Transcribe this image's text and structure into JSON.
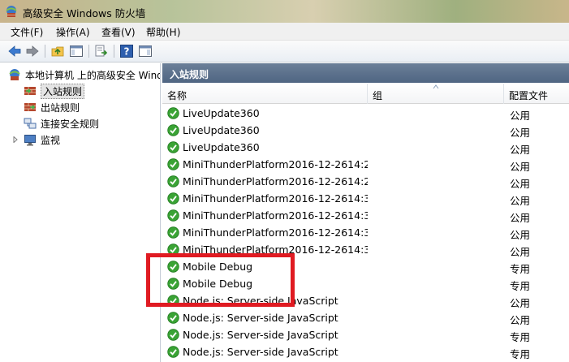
{
  "window": {
    "title": "高级安全 Windows 防火墙"
  },
  "menu": [
    "文件(F)",
    "操作(A)",
    "查看(V)",
    "帮助(H)"
  ],
  "toolbar": {
    "buttons": [
      "back-arrow-icon",
      "forward-arrow-icon",
      "folder-up-icon",
      "show-hide-tree-icon",
      "export-list-icon",
      "help-icon",
      "show-hide-action-pane-icon"
    ]
  },
  "tree": {
    "root": "本地计算机 上的高级安全 Windows 防火墙",
    "items": [
      {
        "label": "入站规则",
        "selected": true
      },
      {
        "label": "出站规则",
        "selected": false
      },
      {
        "label": "连接安全规则",
        "selected": false
      },
      {
        "label": "监视",
        "selected": false
      }
    ]
  },
  "pane": {
    "title": "入站规则",
    "columns": [
      "名称",
      "组",
      "配置文件"
    ],
    "rows": [
      {
        "name": "LiveUpdate360",
        "group": "",
        "profile": "公用"
      },
      {
        "name": "LiveUpdate360",
        "group": "",
        "profile": "公用"
      },
      {
        "name": "LiveUpdate360",
        "group": "",
        "profile": "公用"
      },
      {
        "name": "MiniThunderPlatform2016-12-2614:2...",
        "group": "",
        "profile": "公用"
      },
      {
        "name": "MiniThunderPlatform2016-12-2614:2...",
        "group": "",
        "profile": "公用"
      },
      {
        "name": "MiniThunderPlatform2016-12-2614:3...",
        "group": "",
        "profile": "公用"
      },
      {
        "name": "MiniThunderPlatform2016-12-2614:3...",
        "group": "",
        "profile": "公用"
      },
      {
        "name": "MiniThunderPlatform2016-12-2614:3...",
        "group": "",
        "profile": "公用"
      },
      {
        "name": "MiniThunderPlatform2016-12-2614:3...",
        "group": "",
        "profile": "公用"
      },
      {
        "name": "Mobile Debug",
        "group": "",
        "profile": "专用"
      },
      {
        "name": "Mobile Debug",
        "group": "",
        "profile": "专用"
      },
      {
        "name": "Node.js: Server-side JavaScript",
        "group": "",
        "profile": "公用"
      },
      {
        "name": "Node.js: Server-side JavaScript",
        "group": "",
        "profile": "公用"
      },
      {
        "name": "Node.js: Server-side JavaScript",
        "group": "",
        "profile": "专用"
      },
      {
        "name": "Node.js: Server-side JavaScript",
        "group": "",
        "profile": "专用"
      }
    ]
  },
  "colors": {
    "highlight": "#e01b22",
    "header": "#56708f",
    "enabled_check": "#3aa335"
  }
}
